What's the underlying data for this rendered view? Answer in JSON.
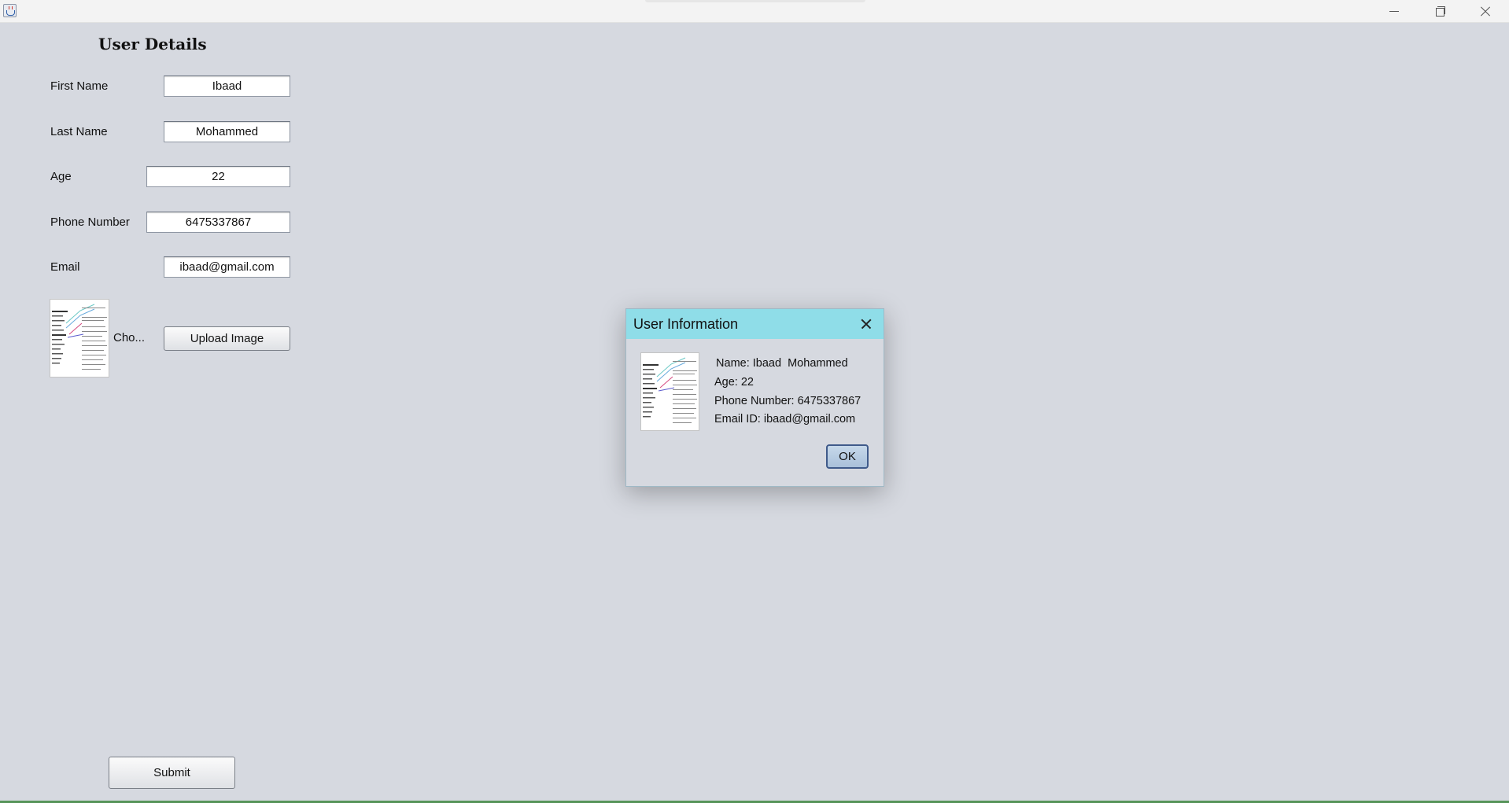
{
  "window": {
    "title_icon": "java-coffee-cup-icon",
    "controls": [
      "minimize-icon",
      "restore-icon",
      "close-icon"
    ]
  },
  "form": {
    "title": "User Details",
    "labels": {
      "first_name": "First Name",
      "last_name": "Last Name",
      "age": "Age",
      "phone": "Phone Number",
      "email": "Email"
    },
    "values": {
      "first_name": "Ibaad",
      "last_name": "Mohammed",
      "age": "22",
      "phone": "6475337867",
      "email": "ibaad@gmail.com"
    },
    "choose_label": "Cho...",
    "upload_button": "Upload Image",
    "submit_button": "Submit"
  },
  "dialog": {
    "title": "User Information",
    "name_line": " Name: Ibaad  Mohammed",
    "age_line": "Age: 22",
    "phone_line": "Phone Number: 6475337867",
    "email_line": "Email ID: ibaad@gmail.com",
    "ok_button": "OK"
  },
  "colors": {
    "background": "#d6d9e0",
    "dialog_titlebar": "#8fdde8",
    "bottom_accent": "#57945a"
  }
}
